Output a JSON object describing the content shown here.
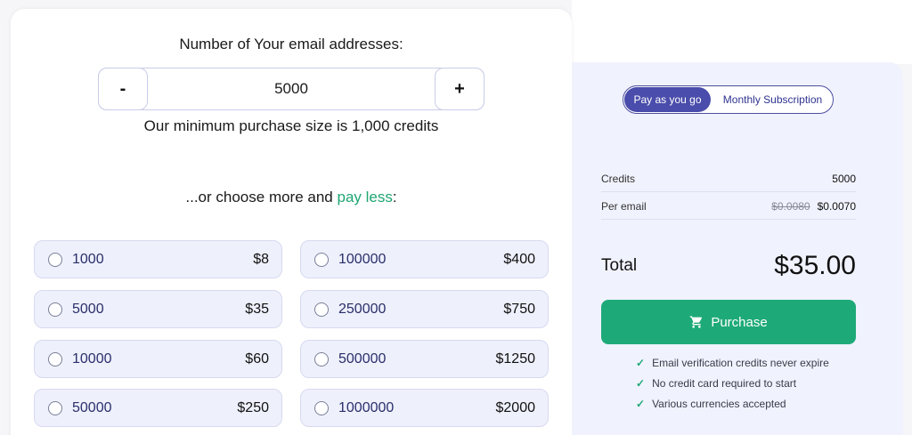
{
  "quantity": {
    "title": "Number of Your email addresses:",
    "minus_label": "-",
    "plus_label": "+",
    "value": "5000",
    "min_note": "Our minimum purchase size is 1,000 credits"
  },
  "more": {
    "prefix": "...or choose more and ",
    "highlight": "pay less",
    "suffix": ":"
  },
  "options": [
    {
      "qty": "1000",
      "price": "$8"
    },
    {
      "qty": "100000",
      "price": "$400"
    },
    {
      "qty": "5000",
      "price": "$35"
    },
    {
      "qty": "250000",
      "price": "$750"
    },
    {
      "qty": "10000",
      "price": "$60"
    },
    {
      "qty": "500000",
      "price": "$1250"
    },
    {
      "qty": "50000",
      "price": "$250"
    },
    {
      "qty": "1000000",
      "price": "$2000"
    }
  ],
  "billing_toggle": {
    "active": "Pay as you go",
    "inactive": "Monthly Subscription"
  },
  "summary": {
    "credits_label": "Credits",
    "credits_value": "5000",
    "per_email_label": "Per email",
    "per_email_old": "$0.0080",
    "per_email_new": "$0.0070"
  },
  "total": {
    "label": "Total",
    "value": "$35.00"
  },
  "purchase_label": "Purchase",
  "benefits": [
    "Email verification credits never expire",
    "No credit card required to start",
    "Various currencies accepted"
  ],
  "colors": {
    "accent_green": "#1eaa78",
    "accent_purple": "#4a4dab",
    "panel_bg": "#f0f2fd"
  }
}
